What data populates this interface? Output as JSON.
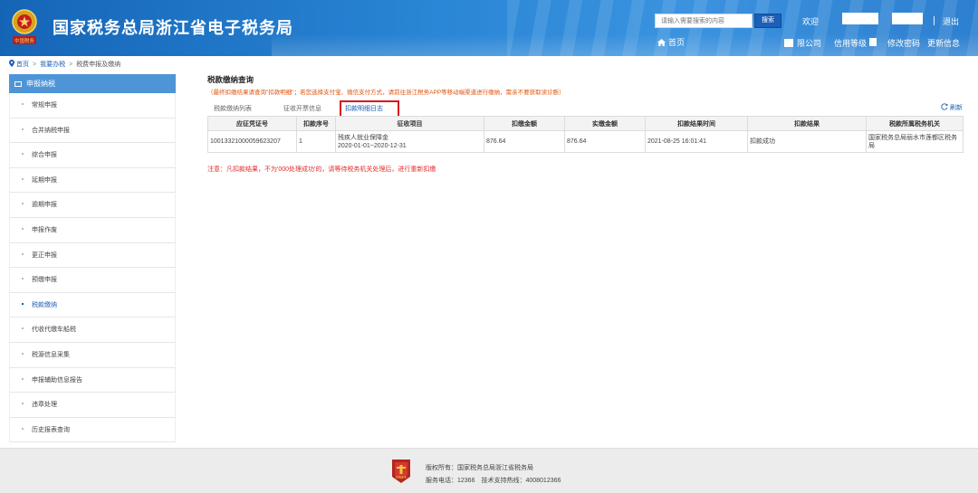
{
  "header": {
    "site_title": "国家税务总局浙江省电子税务局",
    "emblem_text": "中国税务",
    "search_placeholder": "请输入需要搜索的内容",
    "search_button": "搜索",
    "welcome": "欢迎",
    "logout": "退出",
    "home": "首页",
    "company_suffix": "限公司",
    "credit_label": "信用等级",
    "change_password": "修改密码",
    "update_info": "更新信息"
  },
  "breadcrumb": [
    "首页",
    "我要办税",
    "税费申报及缴纳"
  ],
  "sidebar": {
    "title": "申报纳税",
    "items": [
      {
        "label": "常规申报"
      },
      {
        "label": "合并纳税申报"
      },
      {
        "label": "综合申报"
      },
      {
        "label": "延期申报"
      },
      {
        "label": "逾期申报"
      },
      {
        "label": "申报作废"
      },
      {
        "label": "更正申报"
      },
      {
        "label": "预缴申报"
      },
      {
        "label": "税款缴纳"
      },
      {
        "label": "代收代缴车船税"
      },
      {
        "label": "税源信息采集"
      },
      {
        "label": "申报辅助信息报告"
      },
      {
        "label": "违章处理"
      },
      {
        "label": "历史报表查询"
      }
    ],
    "active_index": 8
  },
  "main": {
    "title": "税款缴纳查询",
    "note": "（最终扣缴结果请查询\"扣款明细\"；若您选择支付宝、微信支付方式，请前往浙江税务APP等移动端渠道进行缴纳，需亲不要获取读诊断）",
    "tabs": [
      "税款缴纳列表",
      "征收开票信息",
      "扣款明细日志"
    ],
    "active_tab": 2,
    "refresh": "刷新",
    "table": {
      "headers": [
        "应征凭证号",
        "扣款序号",
        "征收项目",
        "扣缴金额",
        "实缴金额",
        "扣款结果时间",
        "扣款结果",
        "税款所属税务机关"
      ],
      "rows": [
        {
          "voucher_no": "10013321000059623207",
          "seq": "1",
          "item_name": "残疾人就业保障金",
          "item_period": "2020-01-01~2020-12-31",
          "deduct_amount": "876.64",
          "paid_amount": "876.64",
          "result_time": "2021-08-25 16:01:41",
          "result": "扣款成功",
          "authority": "国家税务总局丽水市莲都区税务局"
        }
      ]
    },
    "warning": "注意：凡扣款结果，不为'000处理成功'的，请等待税务机关处理后，进行重新扣缴"
  },
  "footer": {
    "logo_text": "税收业务",
    "copyright": "版权所有：国家税务总局浙江省税务局",
    "contact": "服务电话：12366　技术支持热线：4008012366"
  }
}
